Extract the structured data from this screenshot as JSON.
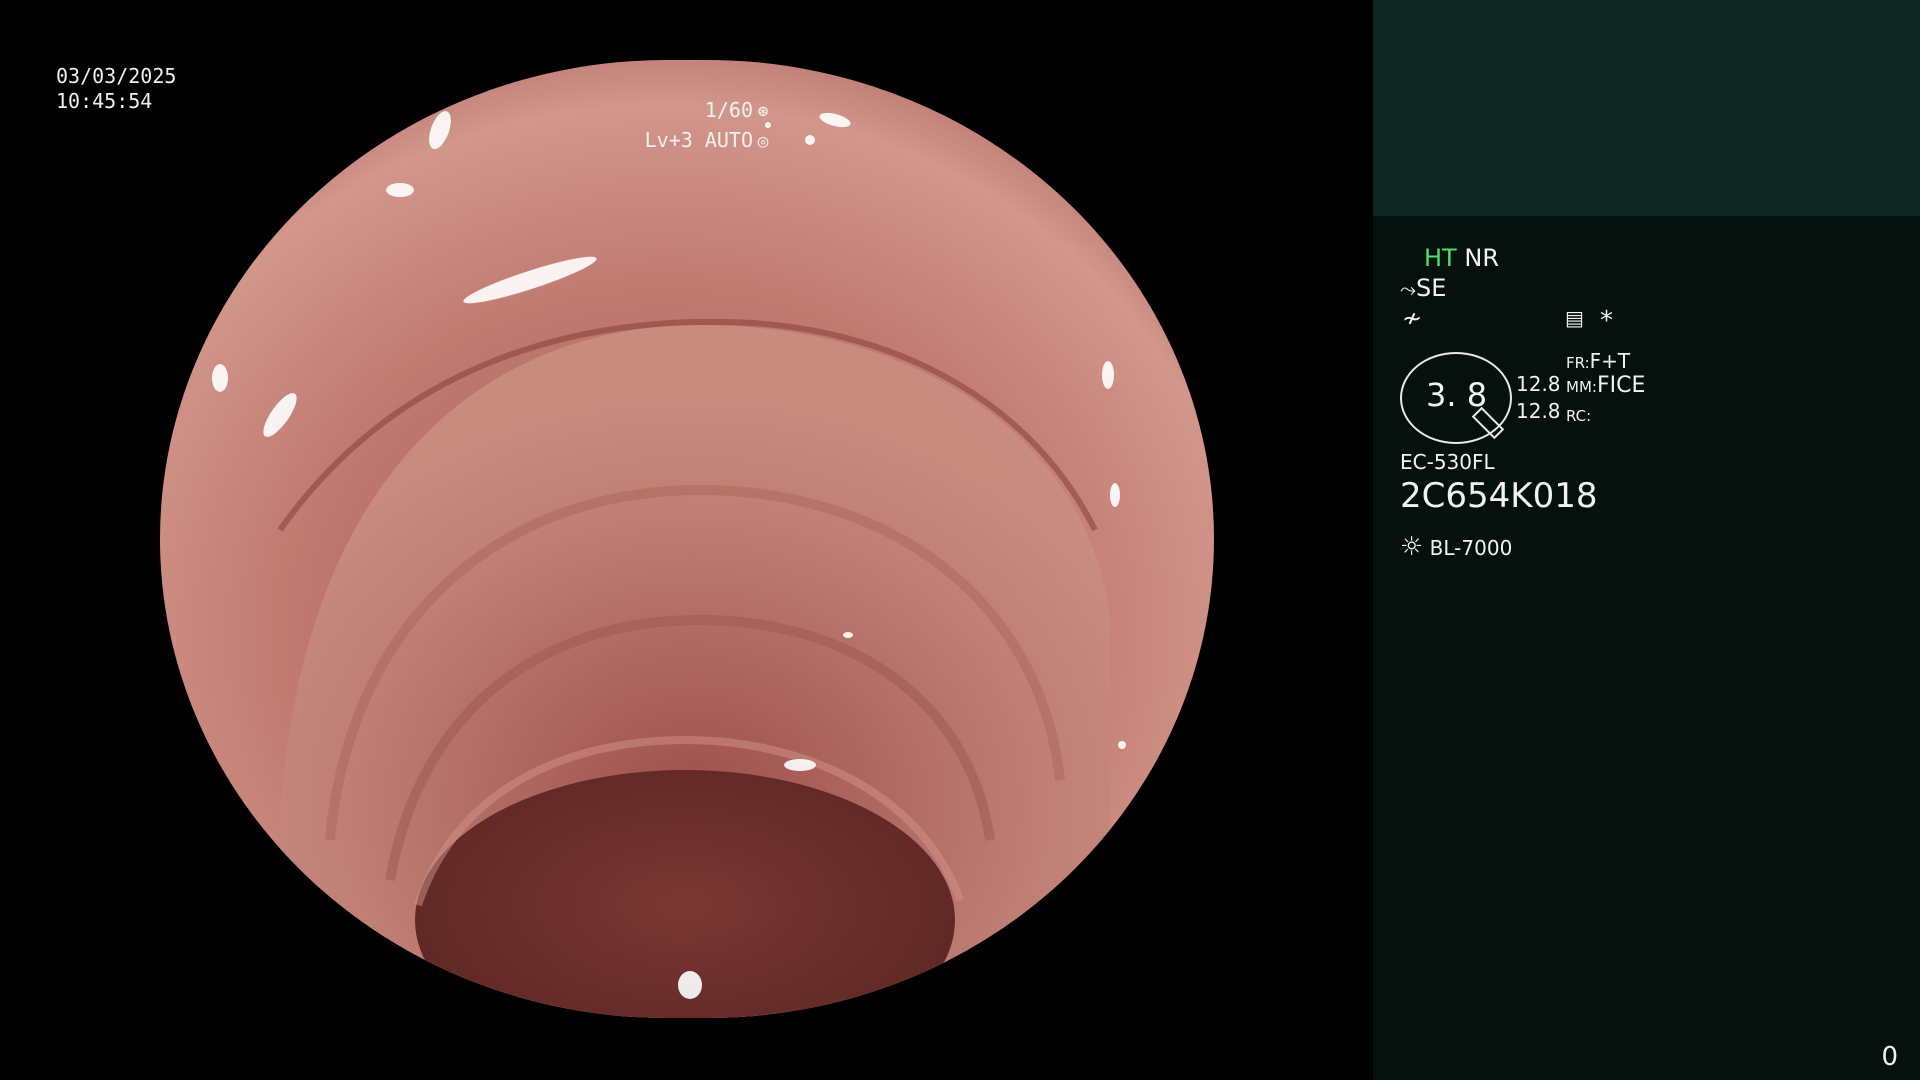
{
  "overlay": {
    "date": "03/03/2025",
    "time": "10:45:54",
    "shutter": "1/60",
    "shutter_icon": "aperture-icon",
    "level": "Lv+3 AUTO",
    "level_icon": "iris-icon"
  },
  "panel": {
    "ht_label": "HT",
    "nr_label": "NR",
    "se_label": "SE",
    "se_icon": "scope-icon",
    "freeze_icon": "freeze-icon",
    "menu_icon": "menu-card-icon",
    "asterisk": "*",
    "mode_value": "3. 8",
    "value_1": "12.8",
    "value_2": "12.8",
    "fr_label": "FR:",
    "fr_value": "F+T",
    "mm_label": "MM:",
    "mm_value": "FICE",
    "rc_label": "RC:",
    "scope_model": "EC-530FL",
    "serial": "2C654K018",
    "light_icon": "light-source-icon",
    "light_source": "BL-7000",
    "counter": "0"
  },
  "colors": {
    "panel_bg": "#06110e",
    "panel_top_bg": "#0f2622",
    "ht_green": "#53e06a",
    "tissue": "#b06a62"
  }
}
